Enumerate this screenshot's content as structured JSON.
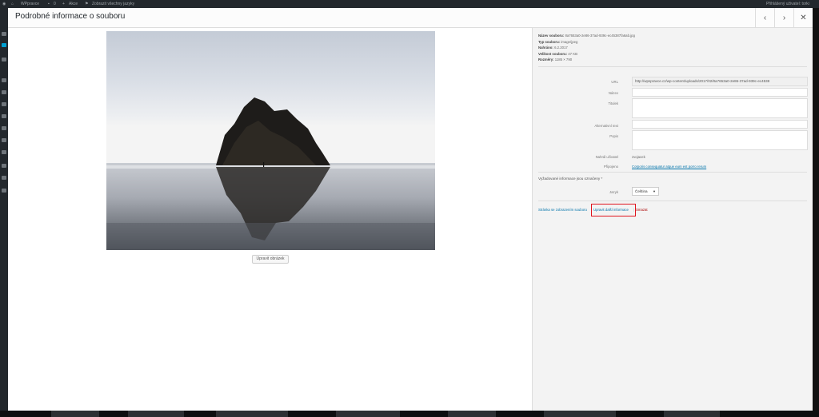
{
  "adminbar": {
    "site_name": "WPpravce",
    "comments_count": "0",
    "new_label": "Akce",
    "languages_label": "Zobrazit všechny jazyky",
    "user_greeting": "Přihlášený uživatel: torki"
  },
  "modal": {
    "title": "Podrobné informace o souboru",
    "prev_icon": "chevron-left-icon",
    "next_icon": "chevron-right-icon",
    "close_icon": "close-icon"
  },
  "media": {
    "edit_image_label": "Upravit obrázek"
  },
  "file_info": {
    "filename_label": "Název souboru:",
    "filename": "8a7653a0-2e86-37ad-939c-ec45387fa6ab.jpg",
    "type_label": "Typ souboru:",
    "type": "image/jpeg",
    "uploaded_label": "Nahráno:",
    "uploaded": "6.2.2017",
    "size_label": "Velikost souboru:",
    "size": "47 KB",
    "dimensions_label": "Rozměry:",
    "dimensions": "1185 × 790"
  },
  "fields": {
    "url_label": "URL",
    "url_value": "http://wpspravce.cz/wp-content/uploads/2017/02/8a7653a0-2e86-37ad-939c-ec4538",
    "title_label": "Název",
    "title_value": "",
    "caption_label": "Titulek",
    "caption_value": "",
    "alt_label": "Alternativní text",
    "alt_value": "",
    "description_label": "Popis",
    "description_value": "",
    "uploader_label": "Nahrál uživatel",
    "uploader_value": "zvojacek",
    "attached_label": "Připojeno",
    "attached_value": "Corporis consequatur atque eum est porro rerum"
  },
  "required_note": "Vyžadované informace jsou označeny *",
  "language": {
    "label": "Jazyk",
    "selected": "Čeština",
    "arrow": "▼"
  },
  "actions": {
    "view_label": "Stránka se zobrazením souboru",
    "edit_label": "Upravit další informace",
    "delete_label": "Smazat",
    "sep1": "|",
    "sep2": "|"
  },
  "colors": {
    "highlight": "#e0141e",
    "link": "#0073aa",
    "delete": "#aa0000"
  }
}
